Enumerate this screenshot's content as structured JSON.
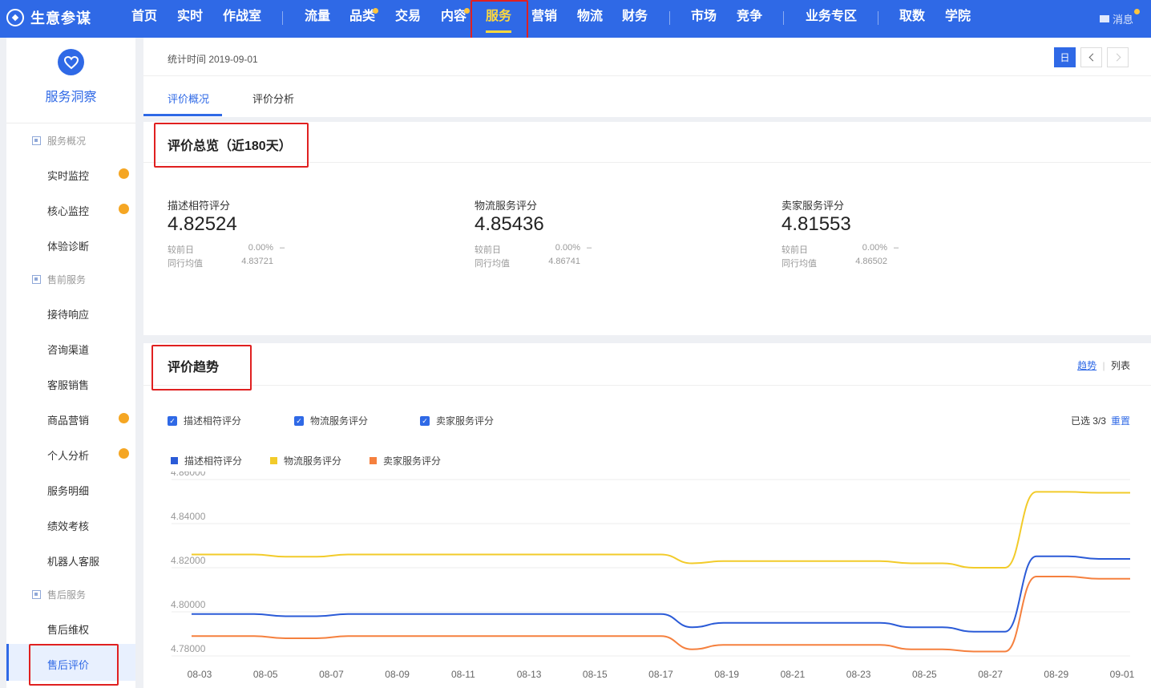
{
  "brand": {
    "name": "生意参谋"
  },
  "nav": {
    "items": [
      "首页",
      "实时",
      "作战室",
      "流量",
      "品类",
      "交易",
      "内容",
      "服务",
      "营销",
      "物流",
      "财务",
      "市场",
      "竞争",
      "业务专区",
      "取数",
      "学院"
    ],
    "active": "服务",
    "message_label": "消息"
  },
  "sidebar": {
    "title": "服务洞察",
    "groups": [
      {
        "label": "服务概况",
        "items": [
          "实时监控",
          "核心监控",
          "体验诊断"
        ]
      },
      {
        "label": "售前服务",
        "items": [
          "接待响应",
          "咨询渠道",
          "客服销售",
          "商品营销",
          "个人分析",
          "服务明细",
          "绩效考核",
          "机器人客服"
        ]
      },
      {
        "label": "售后服务",
        "items": [
          "售后维权",
          "售后评价"
        ]
      }
    ],
    "active_item": "售后评价"
  },
  "header": {
    "stat_time": "统计时间 2019-09-01",
    "date_button": "日",
    "tabs": [
      "评价概况",
      "评价分析"
    ],
    "active_tab": "评价概况"
  },
  "overview": {
    "title": "评价总览（近180天）",
    "metrics": [
      {
        "label": "描述相符评分",
        "value": "4.82524",
        "compare_label": "较前日",
        "compare_value": "0.00%",
        "compare_trend": "–",
        "peer_label": "同行均值",
        "peer_value": "4.83721"
      },
      {
        "label": "物流服务评分",
        "value": "4.85436",
        "compare_label": "较前日",
        "compare_value": "0.00%",
        "compare_trend": "–",
        "peer_label": "同行均值",
        "peer_value": "4.86741"
      },
      {
        "label": "卖家服务评分",
        "value": "4.81553",
        "compare_label": "较前日",
        "compare_value": "0.00%",
        "compare_trend": "–",
        "peer_label": "同行均值",
        "peer_value": "4.86502"
      }
    ]
  },
  "trend": {
    "title": "评价趋势",
    "view_trend": "趋势",
    "view_list": "列表",
    "checkboxes": [
      "描述相符评分",
      "物流服务评分",
      "卖家服务评分"
    ],
    "selected_text": "已选 3/3",
    "reset_label": "重置"
  },
  "chart_data": {
    "type": "line",
    "x": [
      "08-03",
      "08-04",
      "08-05",
      "08-06",
      "08-07",
      "08-08",
      "08-09",
      "08-10",
      "08-11",
      "08-12",
      "08-13",
      "08-14",
      "08-15",
      "08-16",
      "08-17",
      "08-18",
      "08-19",
      "08-20",
      "08-21",
      "08-22",
      "08-23",
      "08-24",
      "08-25",
      "08-26",
      "08-27",
      "08-28",
      "08-29",
      "08-30",
      "08-31",
      "09-01"
    ],
    "x_tick_labels": [
      "08-03",
      "08-05",
      "08-07",
      "08-09",
      "08-11",
      "08-13",
      "08-15",
      "08-17",
      "08-19",
      "08-21",
      "08-23",
      "08-25",
      "08-27",
      "08-29",
      "09-01"
    ],
    "ylim": [
      4.78,
      4.86
    ],
    "y_ticks": [
      "4.78000",
      "4.80000",
      "4.82000",
      "4.84000",
      "4.86000"
    ],
    "grid": true,
    "legend_position": "top-left",
    "series": [
      {
        "name": "描述相符评分",
        "color": "#2b5bd7",
        "values": [
          4.799,
          4.799,
          4.799,
          4.798,
          4.798,
          4.799,
          4.799,
          4.799,
          4.799,
          4.799,
          4.799,
          4.799,
          4.799,
          4.799,
          4.799,
          4.799,
          4.793,
          4.795,
          4.795,
          4.795,
          4.795,
          4.795,
          4.795,
          4.793,
          4.793,
          4.791,
          4.791,
          4.8252,
          4.8252,
          4.824,
          4.824
        ]
      },
      {
        "name": "物流服务评分",
        "color": "#f2cb2a",
        "values": [
          4.826,
          4.826,
          4.826,
          4.825,
          4.825,
          4.826,
          4.826,
          4.826,
          4.826,
          4.826,
          4.826,
          4.826,
          4.826,
          4.826,
          4.826,
          4.826,
          4.822,
          4.823,
          4.823,
          4.823,
          4.823,
          4.823,
          4.823,
          4.822,
          4.822,
          4.82,
          4.82,
          4.8544,
          4.8544,
          4.854,
          4.854
        ]
      },
      {
        "name": "卖家服务评分",
        "color": "#f5803e",
        "values": [
          4.789,
          4.789,
          4.789,
          4.788,
          4.788,
          4.789,
          4.789,
          4.789,
          4.789,
          4.789,
          4.789,
          4.789,
          4.789,
          4.789,
          4.789,
          4.789,
          4.783,
          4.785,
          4.785,
          4.785,
          4.785,
          4.785,
          4.785,
          4.783,
          4.783,
          4.782,
          4.782,
          4.816,
          4.816,
          4.815,
          4.815
        ]
      }
    ]
  }
}
